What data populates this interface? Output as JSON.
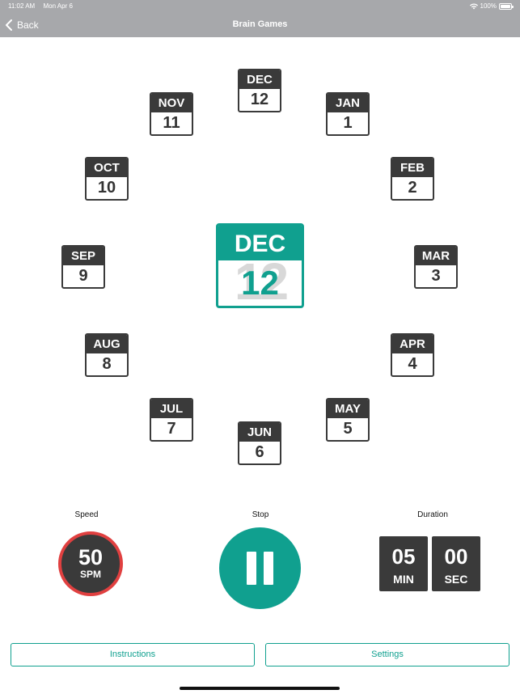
{
  "status_bar": {
    "time": "11:02 AM",
    "date": "Mon Apr 6",
    "battery": "100%"
  },
  "nav": {
    "back_label": "Back",
    "title": "Brain Games"
  },
  "clock_months": [
    {
      "month": "DEC",
      "day": "12"
    },
    {
      "month": "JAN",
      "day": "1"
    },
    {
      "month": "FEB",
      "day": "2"
    },
    {
      "month": "MAR",
      "day": "3"
    },
    {
      "month": "APR",
      "day": "4"
    },
    {
      "month": "MAY",
      "day": "5"
    },
    {
      "month": "JUN",
      "day": "6"
    },
    {
      "month": "JUL",
      "day": "7"
    },
    {
      "month": "AUG",
      "day": "8"
    },
    {
      "month": "SEP",
      "day": "9"
    },
    {
      "month": "OCT",
      "day": "10"
    },
    {
      "month": "NOV",
      "day": "11"
    }
  ],
  "current": {
    "month": "DEC",
    "day": "12"
  },
  "controls": {
    "speed_label": "Speed",
    "speed_value": "50",
    "speed_unit": "SPM",
    "stop_label": "Stop",
    "duration_label": "Duration",
    "minutes_value": "05",
    "minutes_unit": "MIN",
    "seconds_value": "00",
    "seconds_unit": "SEC"
  },
  "buttons": {
    "instructions": "Instructions",
    "settings": "Settings"
  },
  "colors": {
    "accent": "#10a08f",
    "dark": "#3a3a3a",
    "speed_ring": "#e04040",
    "bar": "#a7a8ab"
  }
}
